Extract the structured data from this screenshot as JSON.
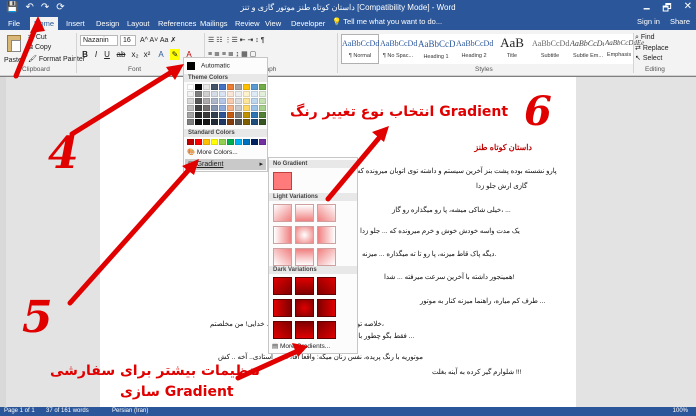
{
  "titlebar": {
    "title": "داستان کوتاه طنز موتور گازی و تنز [Compatibility Mode] - Word",
    "qat": [
      "💾",
      "↶",
      "↷",
      "⟳"
    ],
    "win": [
      "🗕",
      "🗗",
      "✕"
    ]
  },
  "tabs": [
    "File",
    "Home",
    "Insert",
    "Design",
    "Layout",
    "References",
    "Mailings",
    "Review",
    "View",
    "Developer"
  ],
  "tell_me": "💡 Tell me what you want to do...",
  "right_actions": {
    "signin": "Sign in",
    "share": "Share"
  },
  "ribbon": {
    "clipboard": {
      "paste": "Paste",
      "cut": "Cut",
      "copy": "Copy",
      "painter": "Format Painter",
      "label": "Clipboard"
    },
    "font": {
      "name": "Nazanin",
      "size": "16",
      "bold": "B",
      "italic": "I",
      "underline": "U",
      "label": "Font"
    },
    "paragraph": {
      "label": "Paragraph"
    },
    "styles": {
      "label": "Styles",
      "items": [
        {
          "preview": "AaBbCcDdEe",
          "name": "¶ Normal"
        },
        {
          "preview": "AaBbCcDdEe",
          "name": "¶ No Spac..."
        },
        {
          "preview": "AaBbCcDdEe",
          "name": "Heading 1"
        },
        {
          "preview": "AaBbCcDdEe",
          "name": "Heading 2"
        },
        {
          "preview": "AaB",
          "name": "Title"
        },
        {
          "preview": "AaBbCcDdEe",
          "name": "Subtitle"
        },
        {
          "preview": "AaBbCcDdEe",
          "name": "Subtle Em..."
        },
        {
          "preview": "AaBbCcDdEe",
          "name": "Emphasis"
        }
      ]
    },
    "editing": {
      "find": "Find",
      "replace": "Replace",
      "select": "Select",
      "label": "Editing"
    }
  },
  "color_menu": {
    "automatic": "Automatic",
    "theme_header": "Theme Colors",
    "standard_header": "Standard Colors",
    "more_colors": "More Colors...",
    "gradient": "Gradient",
    "theme_top": [
      "#ffffff",
      "#000000",
      "#e7e6e6",
      "#44546a",
      "#4472c4",
      "#ed7d31",
      "#a5a5a5",
      "#ffc000",
      "#5b9bd5",
      "#70ad47"
    ],
    "theme_tints": [
      [
        "#f2f2f2",
        "#7f7f7f",
        "#d0cece",
        "#d6dce4",
        "#d9e2f3",
        "#fbe5d5",
        "#ededed",
        "#fff2cc",
        "#deebf6",
        "#e2efd9"
      ],
      [
        "#d8d8d8",
        "#595959",
        "#aeabab",
        "#adb9ca",
        "#b4c6e7",
        "#f7cbac",
        "#dbdbdb",
        "#fee599",
        "#bdd7ee",
        "#c5e0b3"
      ],
      [
        "#bfbfbf",
        "#3f3f3f",
        "#757070",
        "#8496b0",
        "#8eaadb",
        "#f4b183",
        "#c9c9c9",
        "#ffd965",
        "#9cc3e5",
        "#a8d08d"
      ],
      [
        "#a5a5a5",
        "#262626",
        "#3a3838",
        "#323f4f",
        "#2f5496",
        "#c55a11",
        "#7b7b7b",
        "#bf9000",
        "#2e75b5",
        "#538135"
      ],
      [
        "#7f7f7f",
        "#0c0c0c",
        "#171616",
        "#222a35",
        "#1f3763",
        "#833c0b",
        "#525252",
        "#7f6000",
        "#1e4e79",
        "#375623"
      ]
    ],
    "standard": [
      "#c00000",
      "#ff0000",
      "#ffc000",
      "#ffff00",
      "#92d050",
      "#00b050",
      "#00b0f0",
      "#0070c0",
      "#002060",
      "#7030a0"
    ]
  },
  "gradient_panel": {
    "no_gradient": "No Gradient",
    "light": "Light Variations",
    "dark": "Dark Variations",
    "more": "More Gradients..."
  },
  "document": {
    "title": "داستان کوتاه طنز",
    "lines": [
      "پارو نشسته بوده پشت بنز آخرین سیستم و داشته توی اتوبان میرونده که میبینه یک موتور",
      "گازی ارش جلو زدا",
      "خیلی شاکی میشه، پا رو میگذاره رو گاز، ...",
      "یک مدت واسه خودش خوش و خرم میرونده که ... جلو زدا",
      "دیگه پاک قاط میزنه، پا رو تا ته میگذاره ... میزنه.",
      "همینجور داشته با آخرین سرعت میرفته ... شدا!",
      "طرف کم میاره، راهنما میزنه کنار به موتور ...",
      "خلاصه توتایی وامیستن کنار اتوبان، یارو ... خدایی! من مخلصتم،",
      "فقط بگو چطور با این موتور گازی کل ما ...",
      "موتوریه با رنگ پریده، نفس زنان میگه: واقعا آقا، ... ... استادی.. آخه .. کش",
      "شلوارم گیر کرده به آینه بغلت !!!"
    ]
  },
  "status": {
    "page": "Page 1 of 1",
    "words": "37 of 161 words",
    "lang": "Persian (Iran)",
    "zoom": "100%"
  },
  "annotations": {
    "step6": "انتخاب نوع تغییر رنگ Gradient",
    "num6": "6",
    "num4": "4",
    "num5": "5",
    "step5_line1": "تنظیمات بیشتر برای سفارشی",
    "step5_line2": "سازی Gradient"
  }
}
